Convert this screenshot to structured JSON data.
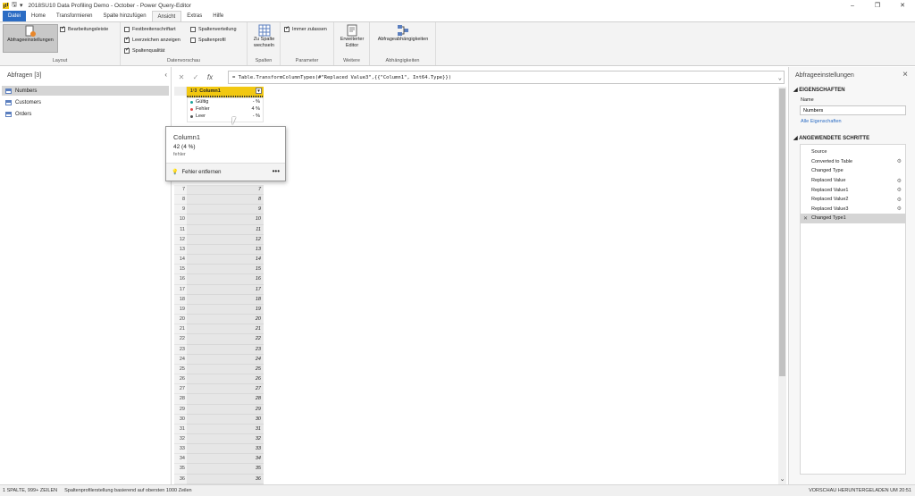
{
  "window": {
    "title": "2018SU10 Data Profiling Demo - October - Power Query-Editor",
    "controls": [
      "–",
      "❐",
      "✕"
    ]
  },
  "tabs": [
    {
      "label": "Datei",
      "kind": "file"
    },
    {
      "label": "Home"
    },
    {
      "label": "Transformieren"
    },
    {
      "label": "Spalte hinzufügen"
    },
    {
      "label": "Ansicht",
      "active": true
    },
    {
      "label": "Extras"
    },
    {
      "label": "Hilfe"
    }
  ],
  "ribbon": {
    "layout": {
      "group": "Layout",
      "query_settings": "Abfrageeinstellungen",
      "formula_bar": "Bearbeitungsleiste"
    },
    "preview": {
      "group": "Datenvorschau",
      "monospace": "Festbreitenschriftart",
      "whitespace": "Leerzeichen anzeigen",
      "quality": "Spaltenqualität",
      "distribution": "Spaltenverteilung",
      "profile": "Spaltenprofil"
    },
    "columns": {
      "group": "Spalten",
      "goto_line1": "Zu Spalte",
      "goto_line2": "wechseln"
    },
    "parameter": {
      "group": "Parameter",
      "always_allow": "Immer zulassen"
    },
    "further": {
      "group": "Weitere",
      "advanced_line1": "Erweiterter",
      "advanced_line2": "Editor"
    },
    "deps": {
      "group": "Abhängigkeiten",
      "query_deps": "Abfrageabhängigkeiten"
    },
    "checked": {
      "formula_bar": true,
      "monospace": false,
      "whitespace": true,
      "quality": true,
      "distribution": false,
      "profile": false,
      "always_allow": true
    }
  },
  "queries": {
    "header": "Abfragen [3]",
    "items": [
      "Numbers",
      "Customers",
      "Orders"
    ],
    "selected": 0
  },
  "formula": {
    "text": "= Table.TransformColumnTypes(#\"Replaced Value3\",{{\"Column1\", Int64.Type}})",
    "cancel": "✕",
    "confirm": "✓",
    "fx": "fx"
  },
  "grid": {
    "column": "Column1",
    "type_icon": "1²3",
    "profile": [
      {
        "label": "Gültig",
        "value": "- %",
        "color": "#1aa39a"
      },
      {
        "label": "Fehler",
        "value": "4 %",
        "color": "#e04848"
      },
      {
        "label": "Leer",
        "value": "- %",
        "color": "#555555"
      }
    ],
    "rows": [
      {
        "n": "7",
        "v": "7"
      },
      {
        "n": "8",
        "v": "8"
      },
      {
        "n": "9",
        "v": "9"
      },
      {
        "n": "10",
        "v": "10"
      },
      {
        "n": "11",
        "v": "11"
      },
      {
        "n": "12",
        "v": "12"
      },
      {
        "n": "13",
        "v": "13"
      },
      {
        "n": "14",
        "v": "14"
      },
      {
        "n": "15",
        "v": "15"
      },
      {
        "n": "16",
        "v": "16"
      },
      {
        "n": "17",
        "v": "17"
      },
      {
        "n": "18",
        "v": "18"
      },
      {
        "n": "19",
        "v": "19"
      },
      {
        "n": "20",
        "v": "20"
      },
      {
        "n": "21",
        "v": "21"
      },
      {
        "n": "22",
        "v": "22"
      },
      {
        "n": "23",
        "v": "23"
      },
      {
        "n": "24",
        "v": "24"
      },
      {
        "n": "25",
        "v": "25"
      },
      {
        "n": "26",
        "v": "26"
      },
      {
        "n": "27",
        "v": "27"
      },
      {
        "n": "28",
        "v": "28"
      },
      {
        "n": "29",
        "v": "29"
      },
      {
        "n": "30",
        "v": "30"
      },
      {
        "n": "31",
        "v": "31"
      },
      {
        "n": "32",
        "v": "32"
      },
      {
        "n": "33",
        "v": "33"
      },
      {
        "n": "34",
        "v": "34"
      },
      {
        "n": "35",
        "v": "35"
      },
      {
        "n": "36",
        "v": "36"
      }
    ]
  },
  "tooltip": {
    "title": "Column1",
    "value": "42 (4 %)",
    "sub": "fehler",
    "action": "Fehler entfernen",
    "more": "•••"
  },
  "settings": {
    "header": "Abfrageeinstellungen",
    "props_title": "EIGENSCHAFTEN",
    "name_label": "Name",
    "name_value": "Numbers",
    "all_props": "Alle Eigenschaften",
    "steps_title": "ANGEWENDETE SCHRITTE",
    "steps": [
      {
        "label": "Source",
        "gear": false
      },
      {
        "label": "Converted to Table",
        "gear": true
      },
      {
        "label": "Changed Type",
        "gear": false
      },
      {
        "label": "Replaced Value",
        "gear": true
      },
      {
        "label": "Replaced Value1",
        "gear": true
      },
      {
        "label": "Replaced Value2",
        "gear": true
      },
      {
        "label": "Replaced Value3",
        "gear": true
      },
      {
        "label": "Changed Type1",
        "gear": false,
        "selected": true
      }
    ]
  },
  "status": {
    "left1": "1 SPALTE, 999+ ZEILEN",
    "left2": "Spaltenprofilerstellung basierend auf obersten 1000 Zeilen",
    "right": "VORSCHAU HERUNTERGELADEN UM 20:51"
  }
}
